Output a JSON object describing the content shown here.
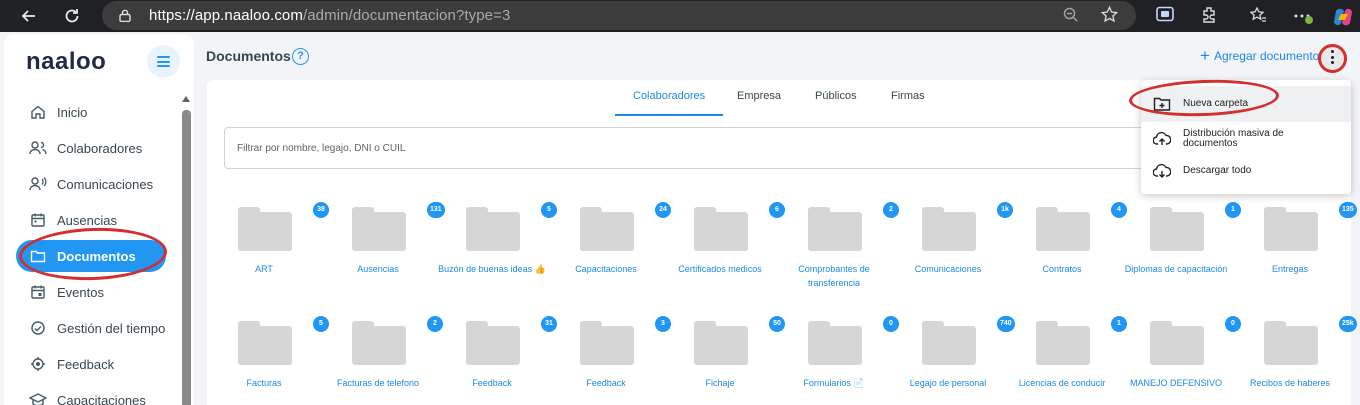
{
  "browser": {
    "url_host": "https://app.naaloo.com",
    "url_path": "/admin/documentacion?type=3",
    "icons": [
      "back-icon",
      "reload-icon",
      "lock-icon",
      "zoom-icon",
      "star-icon",
      "screen-icon",
      "extensions-icon",
      "favorites-icon",
      "more-icon",
      "copilot-icon"
    ]
  },
  "sidebar": {
    "logo": "naaloo",
    "items": [
      {
        "label": "Inicio",
        "icon": "home-icon"
      },
      {
        "label": "Colaboradores",
        "icon": "people-icon"
      },
      {
        "label": "Comunicaciones",
        "icon": "megaphone-icon"
      },
      {
        "label": "Ausencias",
        "icon": "calendar-icon"
      },
      {
        "label": "Documentos",
        "icon": "folder-icon",
        "active": true
      },
      {
        "label": "Eventos",
        "icon": "event-icon"
      },
      {
        "label": "Gestión del tiempo",
        "icon": "time-icon"
      },
      {
        "label": "Feedback",
        "icon": "feedback-icon"
      },
      {
        "label": "Capacitaciones",
        "icon": "graduation-icon"
      }
    ]
  },
  "header": {
    "title": "Documentos",
    "help": "?",
    "add_document": "Agregar documento"
  },
  "tabs": [
    {
      "label": "Colaboradores",
      "active": true
    },
    {
      "label": "Empresa"
    },
    {
      "label": "Públicos"
    },
    {
      "label": "Firmas"
    }
  ],
  "filter": {
    "placeholder": "Filtrar por nombre, legajo, DNI o CUIL"
  },
  "folders": [
    {
      "name": "ART",
      "count": "38"
    },
    {
      "name": "Ausencias",
      "count": "131"
    },
    {
      "name": "Buzón de buenas ideas 👍",
      "count": "5"
    },
    {
      "name": "Capacitaciones",
      "count": "24"
    },
    {
      "name": "Certificados medicos",
      "count": "6"
    },
    {
      "name": "Comprobantes de transferencia",
      "count": "2"
    },
    {
      "name": "Comunicaciones",
      "count": "1k"
    },
    {
      "name": "Contratos",
      "count": "4"
    },
    {
      "name": "Diplomas de capacitación",
      "count": "1"
    },
    {
      "name": "Entregas",
      "count": "135"
    },
    {
      "name": "Facturas",
      "count": "5"
    },
    {
      "name": "Facturas de telefono",
      "count": "2"
    },
    {
      "name": "Feedback",
      "count": "31"
    },
    {
      "name": "Feedback",
      "count": "3"
    },
    {
      "name": "Fichaje",
      "count": "50"
    },
    {
      "name": "Formularios 📄",
      "count": "0"
    },
    {
      "name": "Legajo de personal",
      "count": "740"
    },
    {
      "name": "Licencias de conducir",
      "count": "1"
    },
    {
      "name": "MANEJO DEFENSIVO",
      "count": "0"
    },
    {
      "name": "Recibos de haberes",
      "count": "25k"
    }
  ],
  "dropdown": {
    "items": [
      {
        "label": "Nueva carpeta",
        "icon": "new-folder-icon"
      },
      {
        "label": "Distribución masiva de documentos",
        "icon": "cloud-upload-icon"
      },
      {
        "label": "Descargar todo",
        "icon": "cloud-download-icon"
      }
    ]
  },
  "colors": {
    "accent": "#2196f3",
    "annotation": "#d32f2f",
    "folder": "#d6d6d6"
  }
}
